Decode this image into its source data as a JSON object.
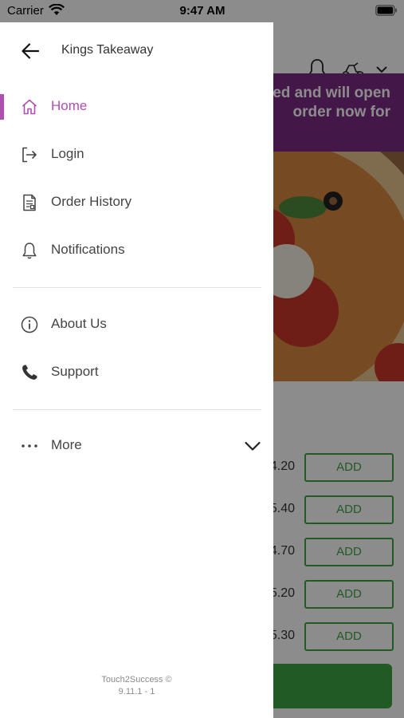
{
  "status_bar": {
    "carrier": "Carrier",
    "time": "9:47 AM"
  },
  "drawer": {
    "title": "Kings Takeaway",
    "menu": [
      {
        "label": "Home",
        "icon": "home-icon",
        "active": true
      },
      {
        "label": "Login",
        "icon": "login-icon"
      },
      {
        "label": "Order History",
        "icon": "receipt-icon"
      },
      {
        "label": "Notifications",
        "icon": "bell-icon"
      },
      {
        "label": "About Us",
        "icon": "info-icon"
      },
      {
        "label": "Support",
        "icon": "phone-icon"
      },
      {
        "label": "More",
        "icon": "more-dots-icon",
        "expandable": true
      }
    ],
    "footer": {
      "brand": "Touch2Success ©",
      "version": "9.11.1 - 1"
    }
  },
  "background_app": {
    "banner_lines": [
      "ed and will open",
      "order now for"
    ],
    "items": [
      {
        "price": "4.20",
        "button": "ADD"
      },
      {
        "price": "5.40",
        "button": "ADD"
      },
      {
        "price": "4.70",
        "button": "ADD"
      },
      {
        "price": "5.20",
        "button": "ADD"
      },
      {
        "price": "5.30",
        "button": "ADD"
      }
    ]
  },
  "colors": {
    "accent": "#b04fb2",
    "banner": "#7a2a83",
    "add_green": "#3ea545"
  }
}
